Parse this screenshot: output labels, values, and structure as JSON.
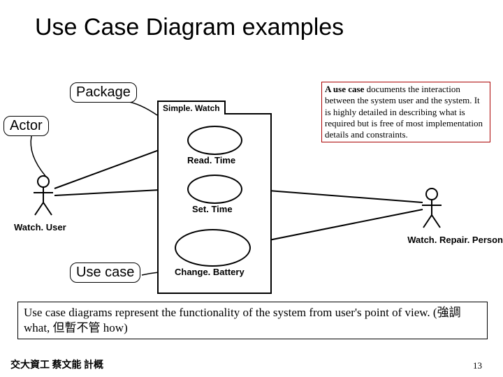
{
  "title": "Use Case Diagram examples",
  "callouts": {
    "package": "Package",
    "actor": "Actor",
    "usecase": "Use case"
  },
  "package_name": "Simple. Watch",
  "usecases": {
    "read_time": "Read. Time",
    "set_time": "Set. Time",
    "change_battery": "Change. Battery"
  },
  "actors": {
    "watch_user": "Watch. User",
    "watch_repair": "Watch. Repair. Person"
  },
  "definition": {
    "lead": "A use case",
    "rest": " documents the interaction between the system user and the system. It is highly detailed in describing what is required but is free of most implementation details and constraints."
  },
  "bottom_text": "Use case diagrams represent the functionality of the system from user's point of view. (強調 what, 但暫不管 how)",
  "footer_left": "交大資工 蔡文能 計概",
  "footer_right": "13"
}
